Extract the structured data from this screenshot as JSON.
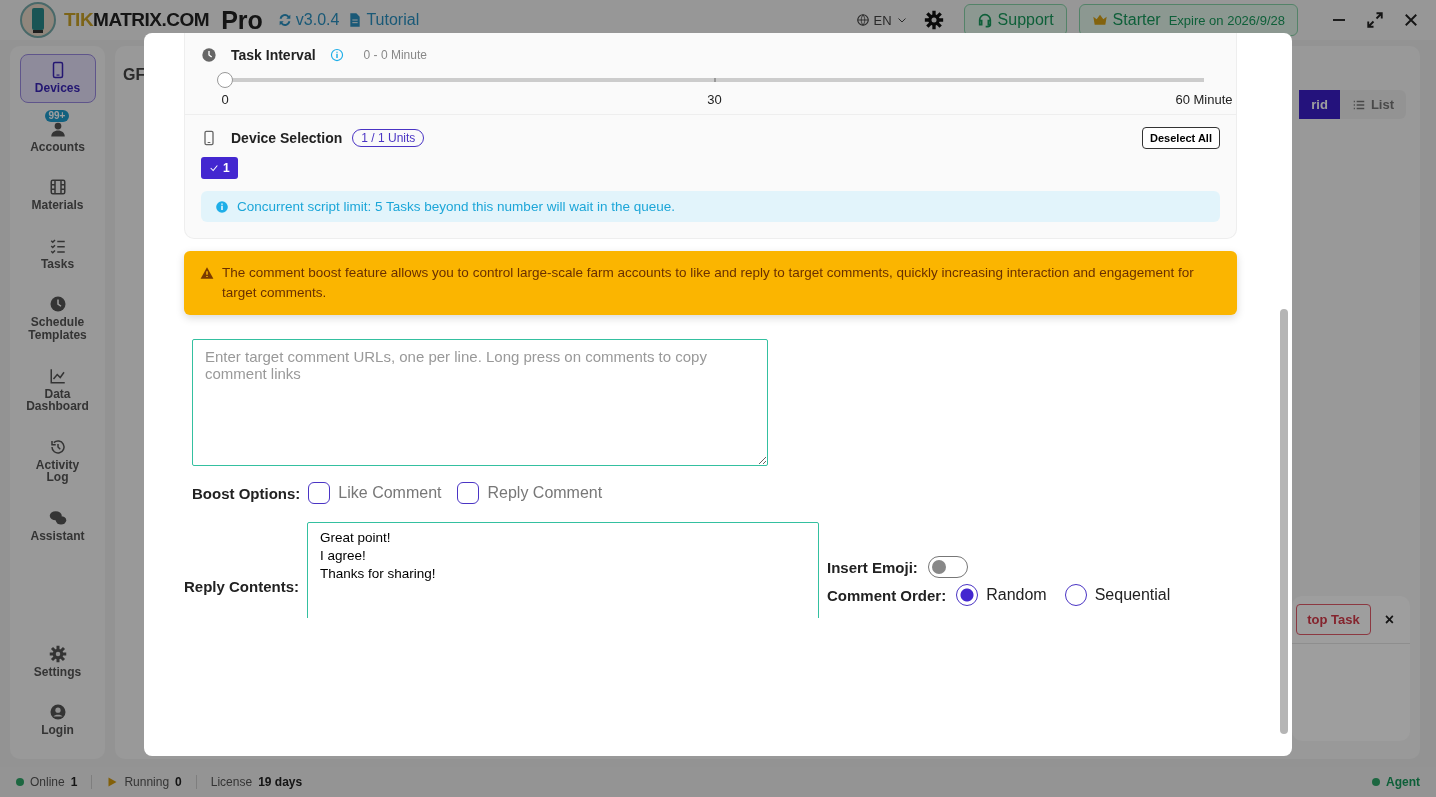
{
  "topbar": {
    "brand_highlight": "TIK",
    "brand_rest": "MATRIX.COM",
    "edition": "Pro",
    "version": "v3.0.4",
    "tutorial": "Tutorial",
    "language": "EN",
    "support": "Support",
    "plan": "Starter",
    "expiry": "Expire on 2026/9/28"
  },
  "sidebar": {
    "items": [
      {
        "label": "Devices",
        "selected": true
      },
      {
        "label": "Accounts",
        "selected": false,
        "badge": "99+"
      },
      {
        "label": "Materials",
        "selected": false
      },
      {
        "label": "Tasks",
        "selected": false
      },
      {
        "label": "Schedule Templates",
        "selected": false
      },
      {
        "label": "Data Dashboard",
        "selected": false
      },
      {
        "label": "Activity Log",
        "selected": false
      },
      {
        "label": "Assistant",
        "selected": false
      }
    ],
    "bottom_items": [
      {
        "label": "Settings",
        "selected": false
      },
      {
        "label": "Login",
        "selected": false
      }
    ]
  },
  "background": {
    "heading": "GF",
    "view_toggle": [
      {
        "label": "rid",
        "selected": true
      },
      {
        "label": "List",
        "selected": false
      }
    ],
    "stop_button": "top Task",
    "close": "×"
  },
  "dialog": {
    "task_interval": {
      "title": "Task Interval",
      "range": "0 - 0 Minute",
      "level": 0,
      "marks": [
        "0",
        "30",
        "60 Minute"
      ]
    },
    "device_selection": {
      "title": "Device Selection",
      "count": "1 / 1 Units",
      "deselect": "Deselect All",
      "devices": [
        {
          "label": "1",
          "selected": true
        }
      ]
    },
    "info": "Concurrent script limit: 5 Tasks beyond this number will wait in the queue.",
    "warning": "The comment boost feature allows you to control large-scale farm accounts to like and reply to target comments, quickly increasing interaction and engagement for target comments.",
    "urls": {
      "placeholder": "Enter target comment URLs, one per line. Long press on comments to copy comment links"
    },
    "boost_options": {
      "label": "Boost Options:",
      "options": [
        {
          "label": "Like Comment",
          "checked": false
        },
        {
          "label": "Reply Comment",
          "checked": false
        }
      ]
    },
    "reply": {
      "label": "Reply Contents:",
      "value": "Great point!\nI agree!\nThanks for sharing!"
    },
    "insert_emoji": {
      "label": "Insert Emoji:",
      "on": false
    },
    "comment_order": {
      "label": "Comment Order:",
      "options": [
        {
          "label": "Random",
          "selected": true
        },
        {
          "label": "Sequential",
          "selected": false
        }
      ]
    }
  },
  "status_bar": {
    "online_label": "Online",
    "online": "1",
    "running_label": "Running",
    "running": "0",
    "license_label": "License",
    "license": "19 days",
    "agent": "Agent"
  }
}
